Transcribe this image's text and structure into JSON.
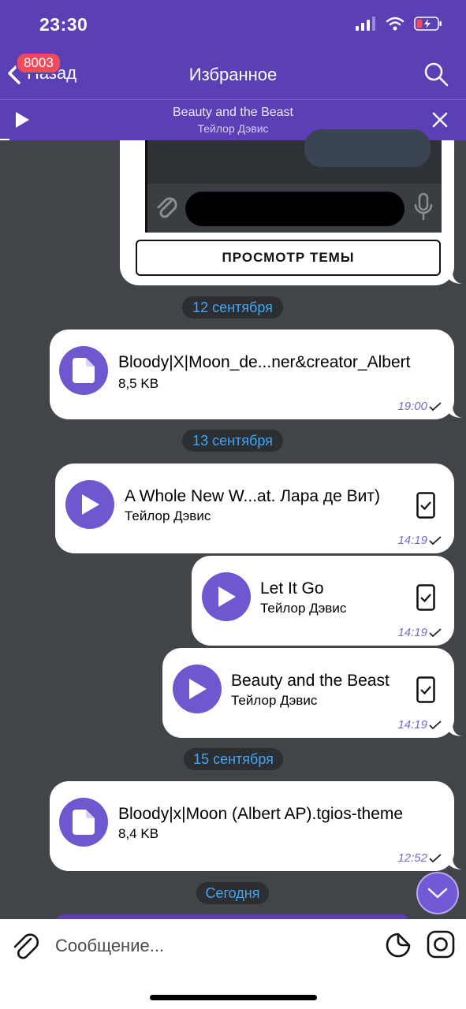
{
  "status_bar": {
    "time": "23:30"
  },
  "nav": {
    "back_label": "Назад",
    "badge": "8003",
    "title": "Избранное"
  },
  "player": {
    "title": "Beauty and the Beast",
    "artist": "Тейлор Дэвис"
  },
  "theme_message": {
    "button_label": "ПРОСМОТР ТЕМЫ"
  },
  "messages": [
    {
      "date": "12 сентября"
    },
    {
      "type": "file",
      "title": "Bloody|X|Moon_de...ner&creator_Albert",
      "subtitle": "8,5 KB",
      "time": "19:00"
    },
    {
      "date": "13 сентября"
    },
    {
      "type": "audio",
      "title": "A Whole New W...at. Лара де Вит)",
      "subtitle": "Тейлор Дэвис",
      "time": "14:19"
    },
    {
      "type": "audio",
      "title": "Let It Go",
      "subtitle": "Тейлор Дэвис",
      "time": "14:19"
    },
    {
      "type": "audio",
      "title": "Beauty and the Beast",
      "subtitle": "Тейлор Дэвис",
      "time": "14:19"
    },
    {
      "date": "15 сентября"
    },
    {
      "type": "file",
      "title": "Bloody|x|Moon (Albert AP).tgios-theme",
      "subtitle": "8,4 KB",
      "time": "12:52"
    },
    {
      "date": "Сегодня"
    }
  ],
  "composer": {
    "placeholder": "Сообщение..."
  },
  "colors": {
    "header": "#5b3fb5",
    "accent": "#6f57cf",
    "background": "#414549",
    "date_text": "#3ea7f5"
  },
  "icons": [
    "back-chevron-icon",
    "search-icon",
    "play-icon",
    "close-icon",
    "file-icon",
    "checkmark-icon",
    "device-check-icon",
    "chevron-down-icon",
    "paperclip-icon",
    "sticker-icon",
    "camera-icon",
    "signal-icon",
    "wifi-icon",
    "battery-icon"
  ]
}
